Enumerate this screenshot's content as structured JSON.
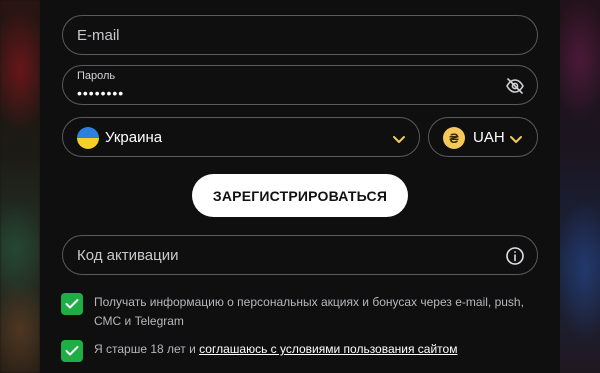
{
  "form": {
    "email": {
      "placeholder": "E-mail",
      "value": ""
    },
    "password": {
      "label": "Пароль",
      "value": "••••••••",
      "toggle_icon": "eye-off-icon"
    },
    "country": {
      "flag_icon": "ukraine-flag-icon",
      "value": "Украина"
    },
    "currency": {
      "icon": "hryvnia-coin-icon",
      "symbol": "₴",
      "value": "UAH"
    },
    "register_label": "ЗАРЕГИСТРИРОВАТЬСЯ",
    "activation_code": {
      "placeholder": "Код активации",
      "info_icon": "info-icon"
    },
    "consents": [
      {
        "checked": true,
        "text": "Получать информацию о персональных акциях и бонусах через e-mail, push, СМС и Telegram"
      },
      {
        "checked": true,
        "text_prefix": "Я старше 18 лет и ",
        "link_text": "соглашаюсь с условиями пользования сайтом"
      }
    ]
  },
  "colors": {
    "accent_chevron": "#f6c85a",
    "checkbox": "#1fae45",
    "panel": "#0f0f10",
    "button": "#ffffff"
  }
}
